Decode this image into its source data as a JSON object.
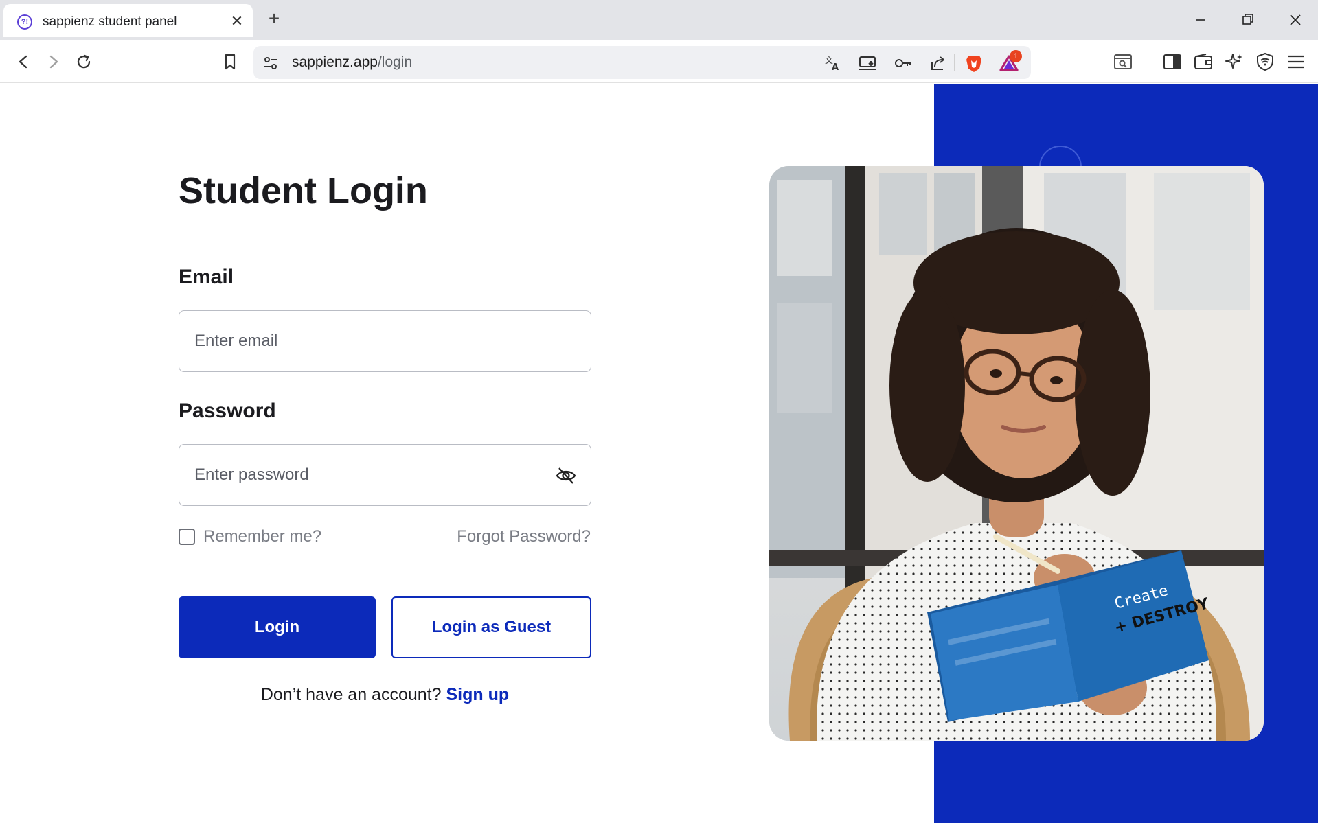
{
  "browser": {
    "tab_title": "sappienz student panel",
    "favicon_text": "?!",
    "url_host": "sappienz.app",
    "url_path": "/login",
    "notification_badge": "1",
    "icons": {
      "back": "back-arrow-icon",
      "forward": "forward-arrow-icon",
      "reload": "reload-icon",
      "bookmark": "bookmark-icon",
      "site_settings": "site-settings-icon",
      "translate": "translate-icon",
      "install": "install-app-icon",
      "password": "key-icon",
      "share": "share-icon",
      "brave_shields": "brave-lion-icon",
      "rewards": "brave-rewards-icon",
      "reader": "reader-mode-icon",
      "sidebar": "sidebar-icon",
      "wallet": "wallet-icon",
      "leo": "ai-sparkle-icon",
      "vpn": "vpn-shield-icon",
      "menu": "hamburger-menu-icon"
    }
  },
  "login": {
    "title": "Student Login",
    "email_label": "Email",
    "email_placeholder": "Enter email",
    "password_label": "Password",
    "password_placeholder": "Enter password",
    "remember_label": "Remember me?",
    "forgot_label": "Forgot Password?",
    "login_button": "Login",
    "guest_button": "Login as Guest",
    "no_account_text": "Don’t have an account?",
    "signup_link": "Sign up"
  },
  "colors": {
    "brand_blue": "#0c2aba",
    "text_dark": "#1b1b1f",
    "muted_text": "#7a7d85"
  },
  "illustration": {
    "subject": "student-with-notebook-photo",
    "notebook_text": "Create + DESTROY"
  }
}
